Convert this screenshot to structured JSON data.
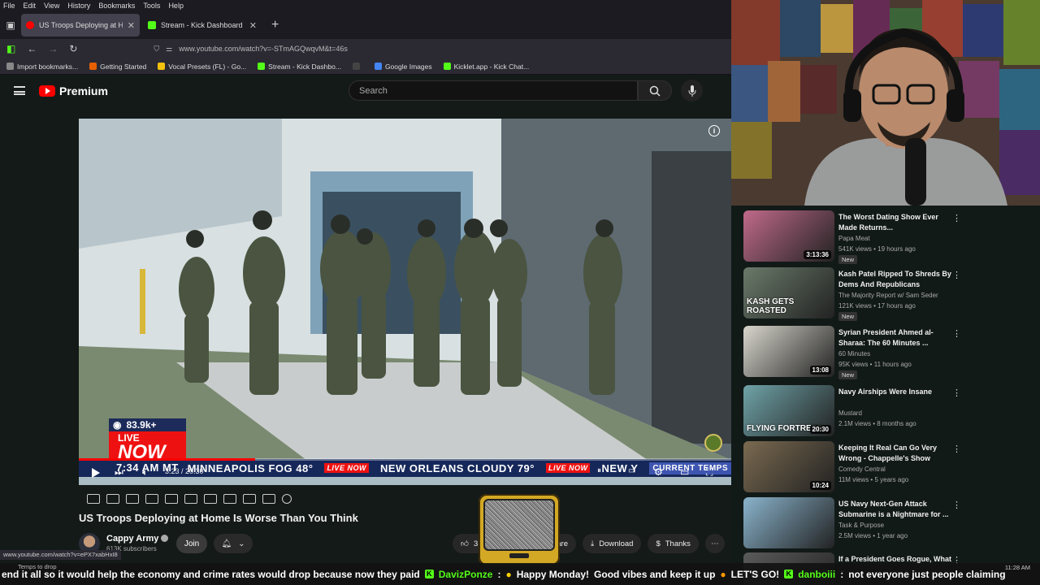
{
  "menu": [
    "File",
    "Edit",
    "View",
    "History",
    "Bookmarks",
    "Tools",
    "Help"
  ],
  "tabs": [
    {
      "label": "US Troops Deploying at Home",
      "color": "#ff0000"
    },
    {
      "label": "Stream - Kick Dashboard",
      "color": "#53fc18"
    }
  ],
  "url": "www.youtube.com/watch?v=-STmAGQwqvM&t=46s",
  "bookmarks": [
    {
      "label": "Import bookmarks...",
      "color": "#888888"
    },
    {
      "label": "Getting Started",
      "color": "#e66000"
    },
    {
      "label": "Vocal Presets (FL) - Go...",
      "color": "#f4c20d"
    },
    {
      "label": "Stream - Kick Dashbo...",
      "color": "#53fc18"
    },
    {
      "label": "",
      "color": "#444444"
    },
    {
      "label": "Google Images",
      "color": "#4285f4"
    },
    {
      "label": "Kicklet.app - Kick Chat...",
      "color": "#53fc18"
    }
  ],
  "youtube": {
    "brand": "Premium",
    "search_placeholder": "Search"
  },
  "player": {
    "viewers": "83.9k+",
    "live_label": "LIVE",
    "now_label": "NOW",
    "ticker_time": "7:34 AM MT",
    "ticker": [
      {
        "text": "MINNEAPOLIS FOG 48°"
      },
      {
        "text": "NEW ORLEANS CLOUDY 79°"
      },
      {
        "text": "NEW Y"
      }
    ],
    "ticker_badge": "LIVE NOW",
    "current_temps": "CURRENT TEMPS",
    "timecode": "3:23 / 20:30",
    "progress": 0.27
  },
  "video": {
    "title": "US Troops Deploying at Home Is Worse Than You Think",
    "channel": "Cappy Army",
    "subscribers": "613K subscribers",
    "join": "Join",
    "like_count": "3",
    "share_label": "are",
    "download": "Download",
    "thanks": "Thanks"
  },
  "status_url": "www.youtube.com/watch?v=ePX7xabHxI8",
  "recommendations": [
    {
      "title": "The Worst Dating Show Ever Made Returns...",
      "channel": "Papa Meat",
      "meta": "541K views • 19 hours ago",
      "badge": "New",
      "duration": "3:13:36",
      "bg": "#c06a8a"
    },
    {
      "title": "Kash Patel Ripped To Shreds By Dems And Republicans",
      "channel": "The Majority Report w/ Sam Seder",
      "meta": "121K views • 17 hours ago",
      "badge": "New",
      "duration": "",
      "bg": "#6a7a6a",
      "overlay": "KASH GETS ROASTED"
    },
    {
      "title": "Syrian President Ahmed al-Sharaa: The 60 Minutes ...",
      "channel": "60 Minutes",
      "meta": "95K views • 11 hours ago",
      "badge": "New",
      "duration": "13:08",
      "bg": "#d8d6cc"
    },
    {
      "title": "Navy Airships Were Insane",
      "channel": "Mustard",
      "meta": "2.1M views • 8 months ago",
      "badge": "",
      "duration": "20:30",
      "bg": "#6fa3a8",
      "overlay": "FLYING FORTRESS"
    },
    {
      "title": "Keeping It Real Can Go Very Wrong - Chappelle's Show",
      "channel": "Comedy Central",
      "meta": "11M views • 5 years ago",
      "badge": "",
      "duration": "10:24",
      "bg": "#7a6a50"
    },
    {
      "title": "US Navy Next-Gen Attack Submarine is a Nightmare for ...",
      "channel": "Task & Purpose",
      "meta": "2.5M views • 1 year ago",
      "badge": "",
      "duration": "",
      "bg": "#8ab4cc"
    },
    {
      "title": "If a President Goes Rogue, What ...",
      "channel": "",
      "meta": "",
      "badge": "",
      "duration": "",
      "bg": "#5a5a5a"
    }
  ],
  "chat": {
    "lead": "end it all so it would help the economy and crime rates would drop because now they paid",
    "msgs": [
      {
        "user": "DavizPonze",
        "text": "Happy Monday!",
        "after": "Good vibes and keep it up"
      },
      {
        "user": "",
        "text": "LET'S GO!"
      },
      {
        "user": "danboiii",
        "text": "not everyone just people claiming"
      }
    ]
  },
  "taskbar_hint": "Temps to drop",
  "clock": "11:28 AM"
}
